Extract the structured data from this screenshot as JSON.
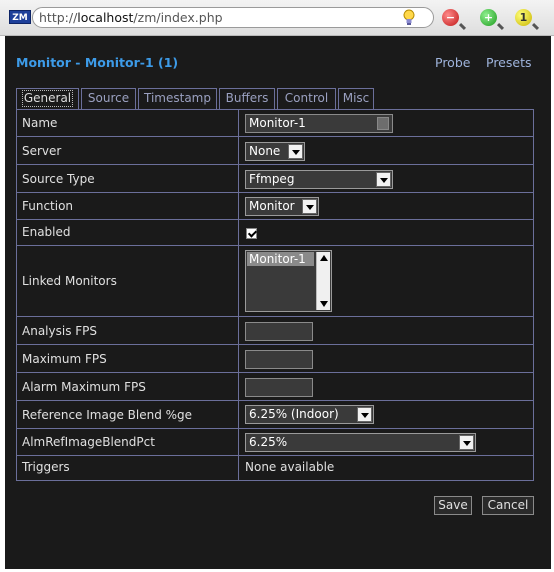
{
  "browser": {
    "favicon_text": "ZM",
    "url_prefix": "http://",
    "url_host": "localhost",
    "url_path": "/zm/index.php",
    "icons": [
      "bulb-icon",
      "zoom-out-icon",
      "zoom-in-icon",
      "zoom-reset-icon"
    ],
    "zoom_minus": "−",
    "zoom_plus": "+",
    "zoom_one": "1"
  },
  "header": {
    "title": "Monitor - Monitor-1 (1)",
    "probe": "Probe",
    "presets": "Presets"
  },
  "tabs": [
    "General",
    "Source",
    "Timestamp",
    "Buffers",
    "Control",
    "Misc"
  ],
  "active_tab": "General",
  "fields": {
    "name": {
      "label": "Name",
      "value": "Monitor-1"
    },
    "server": {
      "label": "Server",
      "value": "None"
    },
    "source_type": {
      "label": "Source Type",
      "value": "Ffmpeg"
    },
    "function": {
      "label": "Function",
      "value": "Monitor"
    },
    "enabled": {
      "label": "Enabled",
      "checked": true
    },
    "linked_monitors": {
      "label": "Linked Monitors",
      "options": [
        "Monitor-1"
      ]
    },
    "analysis_fps": {
      "label": "Analysis FPS",
      "value": ""
    },
    "maximum_fps": {
      "label": "Maximum FPS",
      "value": ""
    },
    "alarm_maximum_fps": {
      "label": "Alarm Maximum FPS",
      "value": ""
    },
    "ref_blend": {
      "label": "Reference Image Blend %ge",
      "value": "6.25% (Indoor)"
    },
    "alm_ref_blend": {
      "label": "AlmRefImageBlendPct",
      "value": "6.25%"
    },
    "triggers": {
      "label": "Triggers",
      "value": "None available"
    }
  },
  "buttons": {
    "save": "Save",
    "cancel": "Cancel"
  },
  "colors": {
    "background": "#1a1a1a",
    "title": "#3d9be8",
    "link": "#9fb4dc",
    "border": "#6b6f9a"
  }
}
